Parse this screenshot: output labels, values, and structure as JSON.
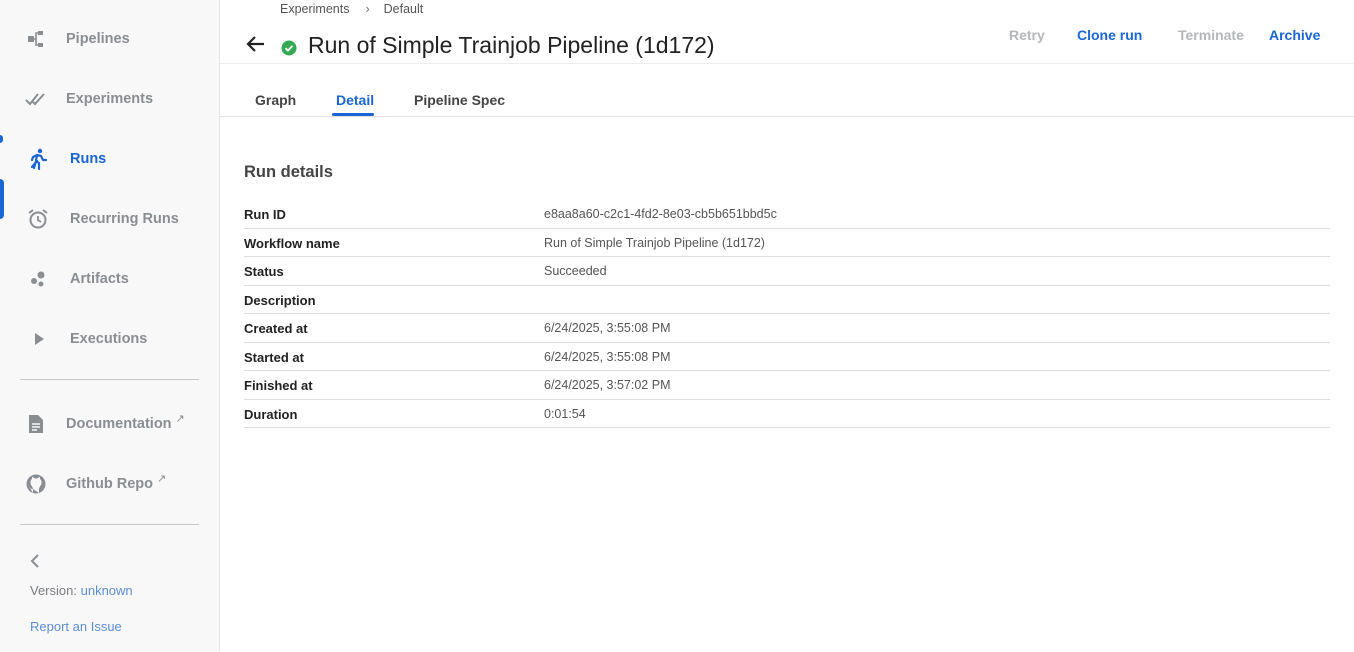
{
  "sidebar": {
    "items": [
      {
        "label": "Pipelines",
        "icon": "pipelines-icon"
      },
      {
        "label": "Experiments",
        "icon": "experiments-icon"
      },
      {
        "label": "Runs",
        "icon": "runs-icon"
      },
      {
        "label": "Recurring Runs",
        "icon": "alarm-icon"
      },
      {
        "label": "Artifacts",
        "icon": "artifacts-icon"
      },
      {
        "label": "Executions",
        "icon": "play-icon"
      },
      {
        "label": "Documentation",
        "icon": "document-icon"
      },
      {
        "label": "Github Repo",
        "icon": "github-icon"
      }
    ],
    "active_item": "Runs",
    "version_label": "Version:",
    "version_value": "unknown",
    "report_issue": "Report an Issue"
  },
  "breadcrumb": [
    "Experiments",
    "Default"
  ],
  "header": {
    "title": "Run of Simple Trainjob Pipeline (1d172)",
    "status": "succeeded",
    "actions": {
      "retry": "Retry",
      "clone": "Clone run",
      "terminate": "Terminate",
      "archive": "Archive"
    }
  },
  "tabs": [
    "Graph",
    "Detail",
    "Pipeline Spec"
  ],
  "active_tab": "Detail",
  "details": {
    "title": "Run details",
    "rows": [
      {
        "key": "Run ID",
        "value": "e8aa8a60-c2c1-4fd2-8e03-cb5b651bbd5c"
      },
      {
        "key": "Workflow name",
        "value": "Run of Simple Trainjob Pipeline (1d172)"
      },
      {
        "key": "Status",
        "value": "Succeeded"
      },
      {
        "key": "Description",
        "value": ""
      },
      {
        "key": "Created at",
        "value": "6/24/2025, 3:55:08 PM"
      },
      {
        "key": "Started at",
        "value": "6/24/2025, 3:55:08 PM"
      },
      {
        "key": "Finished at",
        "value": "6/24/2025, 3:57:02 PM"
      },
      {
        "key": "Duration",
        "value": "0:01:54"
      }
    ]
  },
  "colors": {
    "accent": "#1a66d6",
    "success": "#34a853",
    "muted": "#8a8d91",
    "disabled": "#b5b7ba"
  }
}
